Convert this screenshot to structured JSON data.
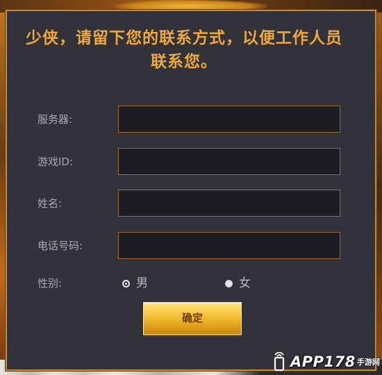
{
  "form": {
    "title": "少侠，请留下您的联系方式，以便工作人员联系您。",
    "fields": [
      {
        "label": "服务器:",
        "value": ""
      },
      {
        "label": "游戏ID:",
        "value": ""
      },
      {
        "label": "姓名:",
        "value": ""
      },
      {
        "label": "电话号码:",
        "value": ""
      }
    ],
    "gender": {
      "label": "性别:",
      "options": [
        {
          "label": "男",
          "selected": true
        },
        {
          "label": "女",
          "selected": false
        }
      ]
    },
    "submit_label": "确定"
  },
  "watermark": {
    "brand": "APP178",
    "sub": "手游网",
    "icon": "phone-signal-icon"
  },
  "colors": {
    "panel_bg": "#32323a",
    "border": "#c48a3a",
    "title": "#f0a83c",
    "button": "#f3bd33"
  }
}
